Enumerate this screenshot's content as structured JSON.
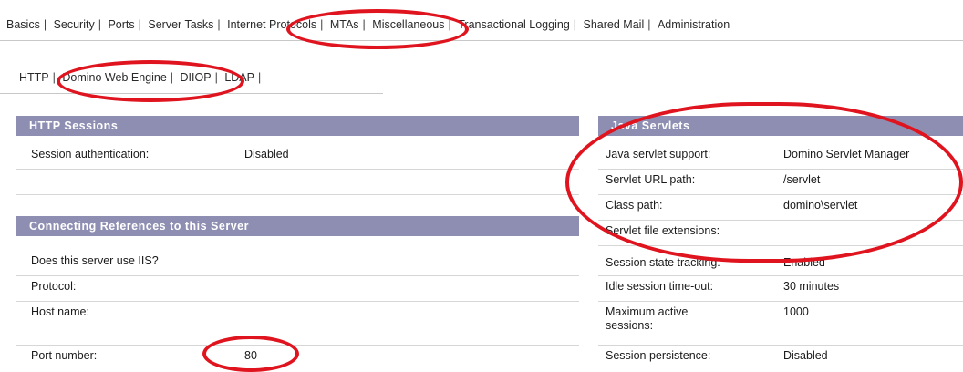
{
  "top_tabs": [
    "Basics",
    "Security",
    "Ports",
    "Server Tasks",
    "Internet Protocols",
    "MTAs",
    "Miscellaneous",
    "Transactional Logging",
    "Shared Mail",
    "Administration"
  ],
  "sub_tabs": [
    "HTTP",
    "Domino Web Engine",
    "DIIOP",
    "LDAP"
  ],
  "left": {
    "http_sessions": {
      "header": "HTTP Sessions",
      "rows": [
        {
          "label": "Session authentication:",
          "value": "Disabled"
        }
      ]
    },
    "connecting": {
      "header": "Connecting References to this Server",
      "rows": [
        {
          "label": "Does this server use IIS?",
          "value": ""
        },
        {
          "label": "Protocol:",
          "value": ""
        },
        {
          "label": "Host name:",
          "value": ""
        },
        {
          "label": "Port number:",
          "value": "80"
        }
      ]
    }
  },
  "right": {
    "java_servlets": {
      "header": "Java Servlets",
      "rows": [
        {
          "label": "Java servlet support:",
          "value": "Domino Servlet Manager"
        },
        {
          "label": "Servlet URL path:",
          "value": "/servlet"
        },
        {
          "label": "Class path:",
          "value": "domino\\servlet"
        },
        {
          "label": "Servlet file extensions:",
          "value": ""
        },
        {
          "label": "Session state tracking:",
          "value": "Enabled"
        },
        {
          "label": "Idle session time-out:",
          "value": "30 minutes"
        },
        {
          "label": "Maximum active sessions:",
          "value": "1000"
        },
        {
          "label": "Session persistence:",
          "value": "Disabled"
        }
      ]
    }
  },
  "colors": {
    "section_header": "#8d8eb2",
    "annotation": "#e0141e"
  }
}
